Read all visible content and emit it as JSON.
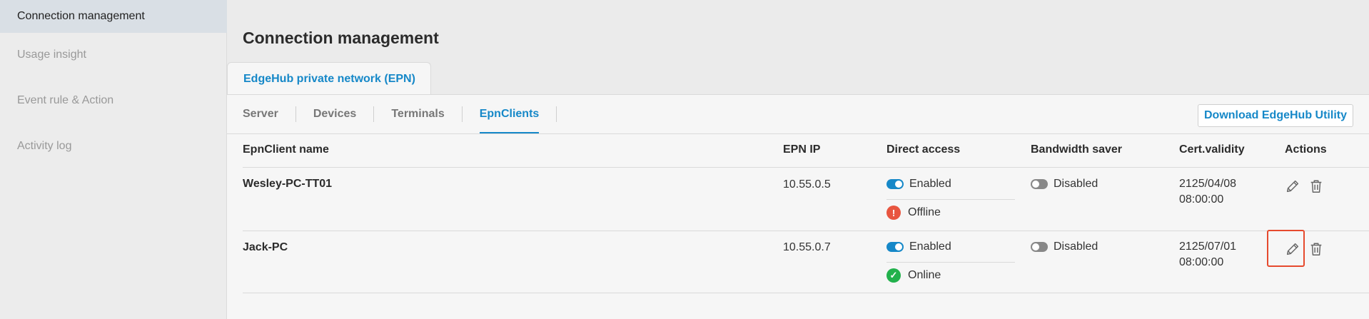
{
  "sidebar": {
    "items": [
      {
        "label": "Connection management",
        "active": true
      },
      {
        "label": "Usage insight",
        "active": false
      },
      {
        "label": "Event rule & Action",
        "active": false
      },
      {
        "label": "Activity log",
        "active": false
      }
    ]
  },
  "page": {
    "title": "Connection management",
    "top_tab": "EdgeHub private network (EPN)"
  },
  "subtabs": [
    "Server",
    "Devices",
    "Terminals",
    "EpnClients"
  ],
  "active_subtab": "EpnClients",
  "download_button": "Download EdgeHub Utility",
  "table": {
    "headers": [
      "EpnClient name",
      "EPN IP",
      "Direct access",
      "Bandwidth saver",
      "Cert.validity",
      "Actions"
    ],
    "rows": [
      {
        "name": "Wesley-PC-TT01",
        "ip": "10.55.0.5",
        "direct_access": "Enabled",
        "status": "Offline",
        "bandwidth_saver": "Disabled",
        "cert_date": "2125/04/08",
        "cert_time": "08:00:00"
      },
      {
        "name": "Jack-PC",
        "ip": "10.55.0.7",
        "direct_access": "Enabled",
        "status": "Online",
        "bandwidth_saver": "Disabled",
        "cert_date": "2125/07/01",
        "cert_time": "08:00:00"
      }
    ]
  },
  "colors": {
    "accent": "#1688c8",
    "offline": "#e8553f",
    "online": "#22b14c",
    "highlight": "#e64a2e"
  }
}
